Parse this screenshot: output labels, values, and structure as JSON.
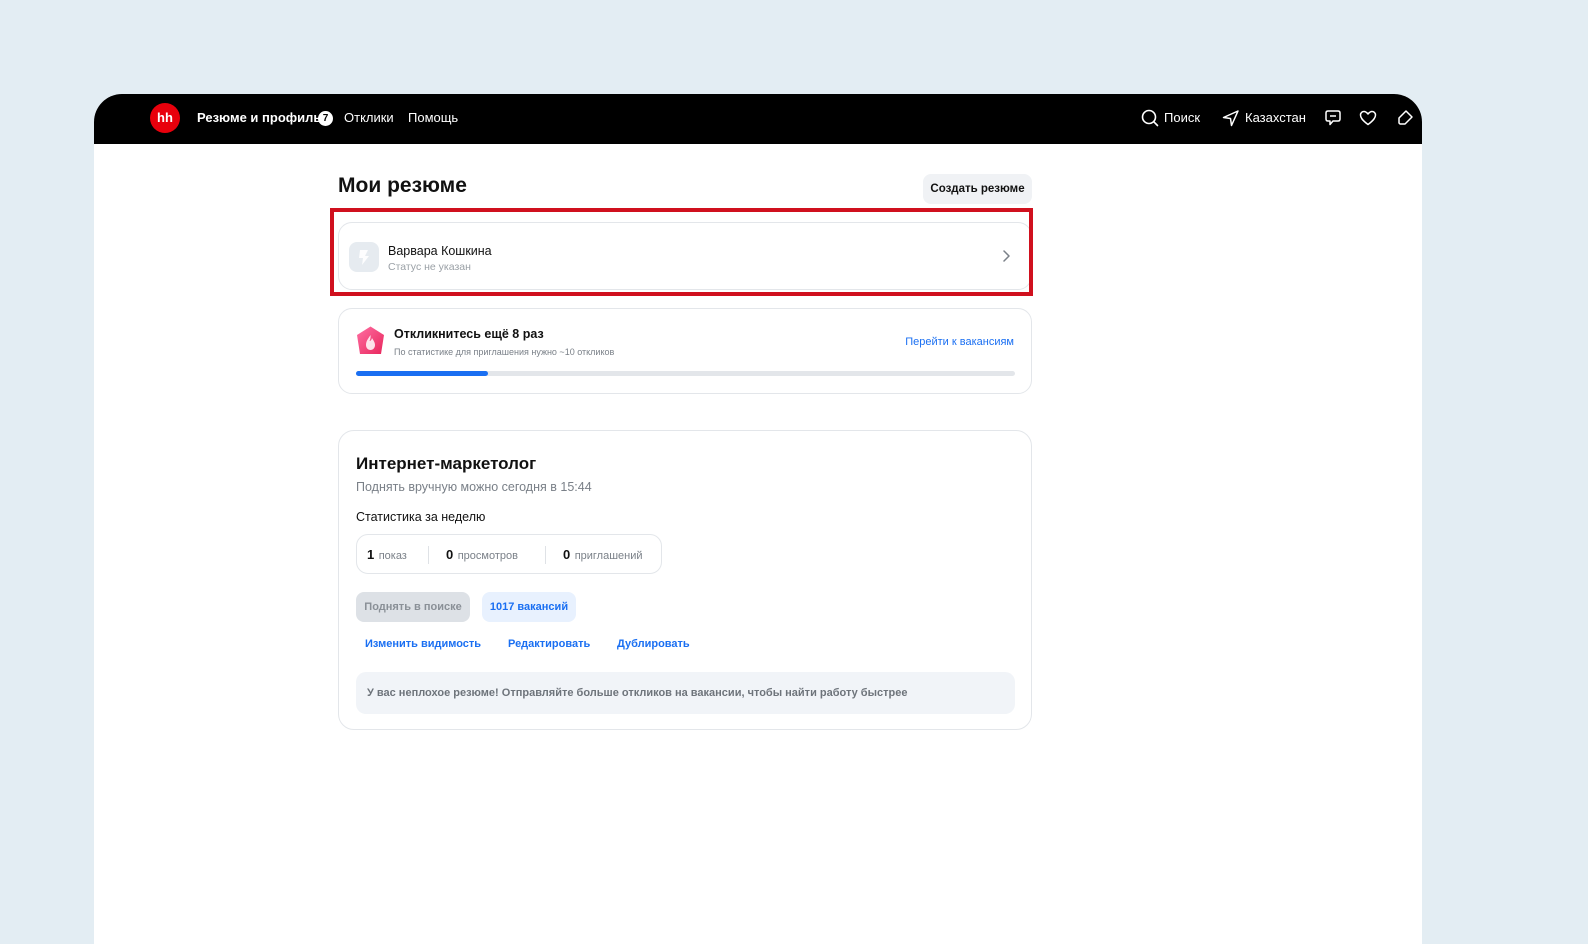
{
  "header": {
    "logo_text": "hh",
    "nav": [
      {
        "label": "Резюме и профиль",
        "badge": "7"
      },
      {
        "label": "Отклики"
      },
      {
        "label": "Помощь"
      }
    ],
    "search_label": "Поиск",
    "region_label": "Казахстан",
    "icons": [
      "search-icon",
      "location-arrow-icon",
      "chat-icon",
      "heart-icon",
      "notification-icon"
    ]
  },
  "main": {
    "title": "Мои резюме",
    "create_button": "Создать резюме",
    "profile": {
      "name": "Варвара Кошкина",
      "status": "Статус не указан"
    },
    "progress": {
      "title": "Откликнитесь ещё 8 раз",
      "subtitle": "По статистике для приглашения нужно ~10 откликов",
      "link": "Перейти к вакансиям",
      "fraction": 0.2
    },
    "resume": {
      "title": "Интернет-маркетолог",
      "raise_info": "Поднять вручную можно сегодня в 15:44",
      "stats_label": "Статистика за неделю",
      "stats": [
        {
          "value": "1",
          "label": "показ"
        },
        {
          "value": "0",
          "label": "просмотров"
        },
        {
          "value": "0",
          "label": "приглашений"
        }
      ],
      "raise_button": "Поднять в поиске",
      "vacancies_button": "1017 вакансий",
      "actions": [
        "Изменить видимость",
        "Редактировать",
        "Дублировать"
      ],
      "tip": "У вас неплохое резюме! Отправляйте больше откликов на вакансии, чтобы найти работу быстрее"
    }
  },
  "colors": {
    "accent": "#1a6ff2",
    "brand": "#e8000c",
    "highlight": "#d0101e"
  }
}
